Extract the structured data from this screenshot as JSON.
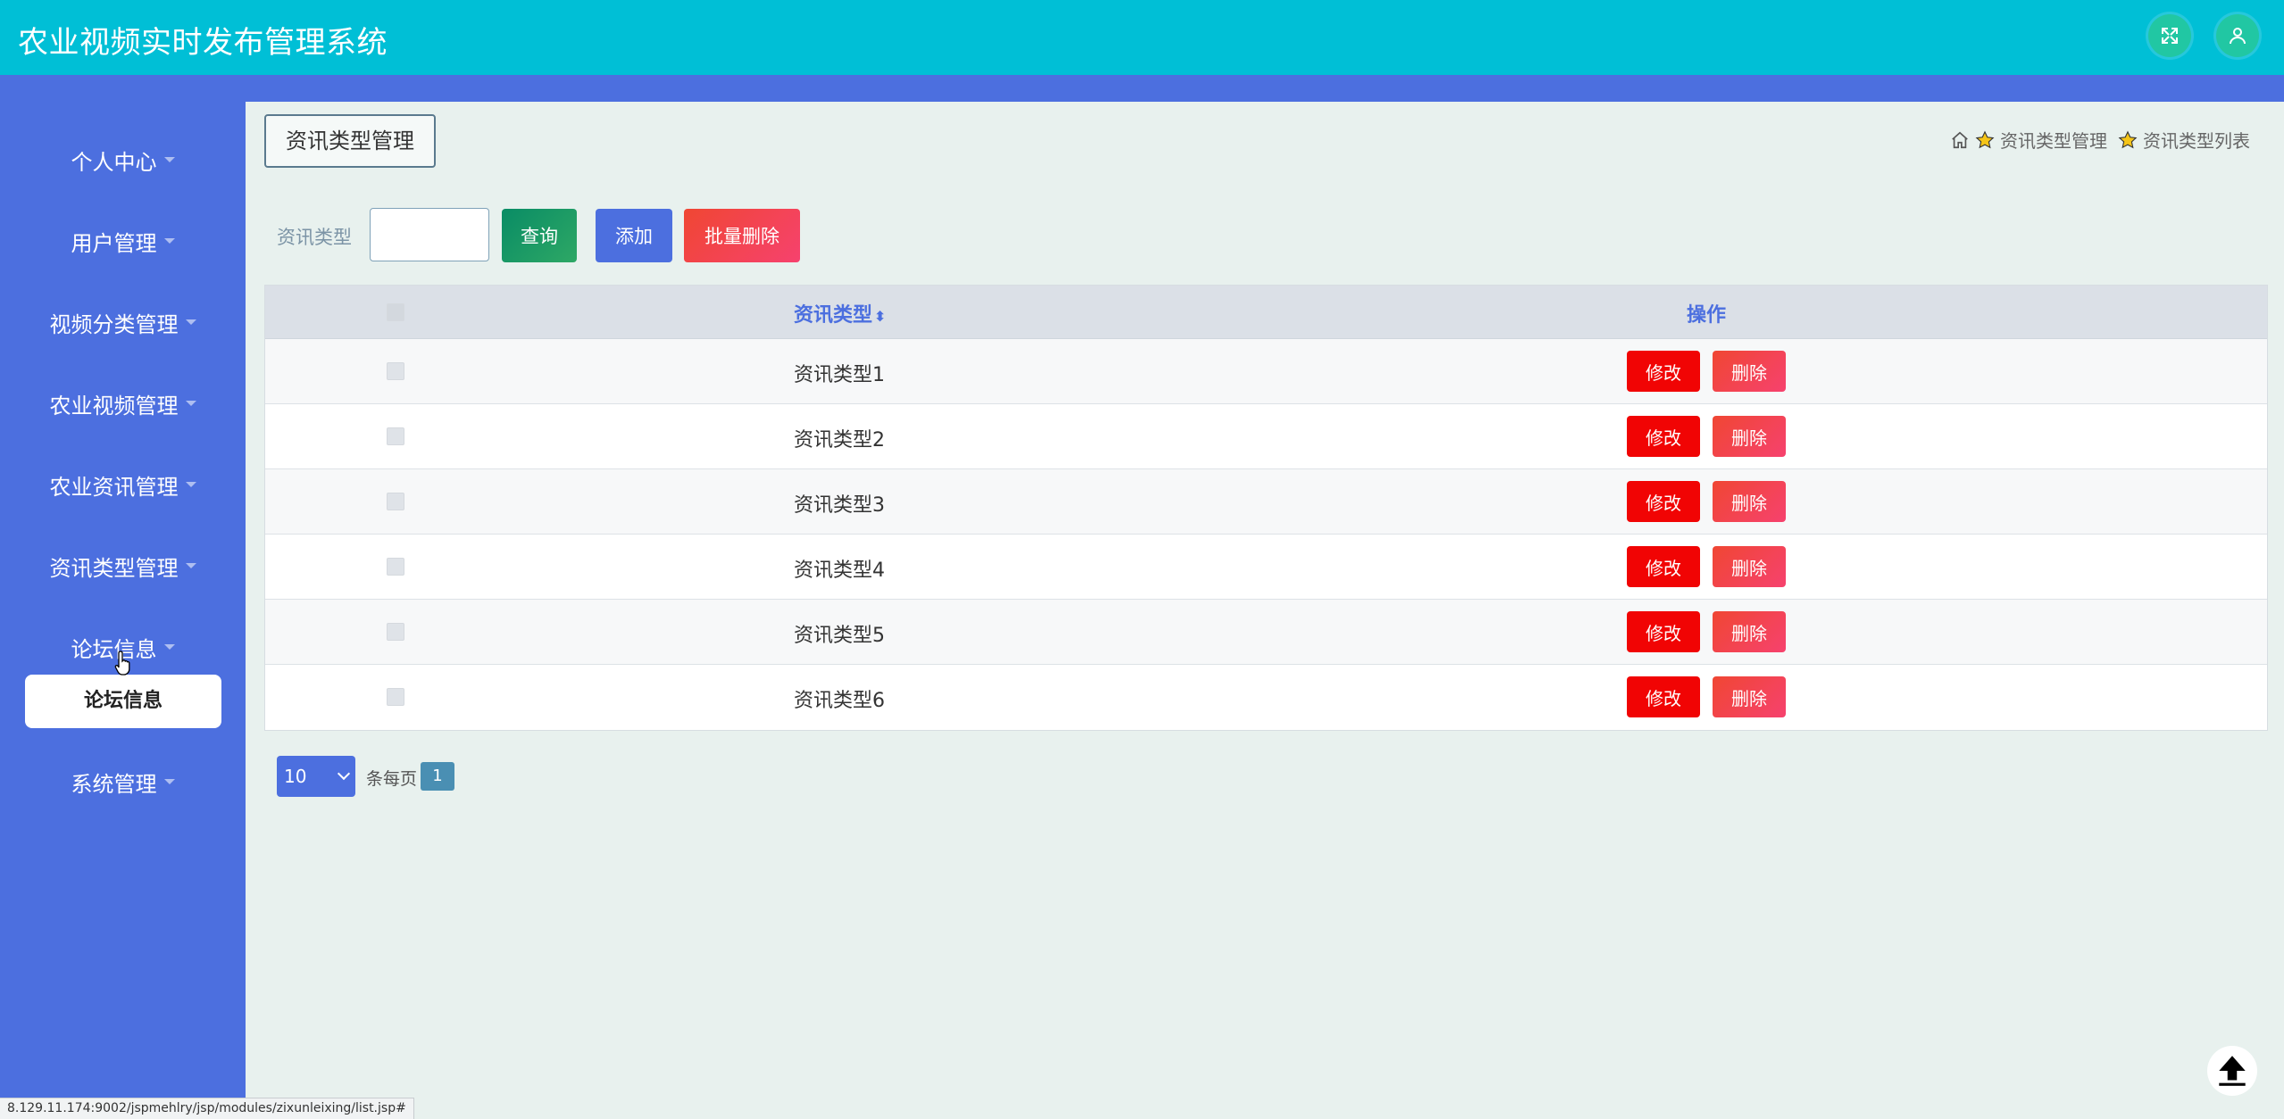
{
  "header": {
    "title": "农业视频实时发布管理系统",
    "fullscreen_icon": "expand-icon",
    "user_icon": "user-icon"
  },
  "sidebar": {
    "items": [
      {
        "label": "个人中心"
      },
      {
        "label": "用户管理"
      },
      {
        "label": "视频分类管理"
      },
      {
        "label": "农业视频管理"
      },
      {
        "label": "农业资讯管理"
      },
      {
        "label": "资讯类型管理"
      },
      {
        "label": "论坛信息"
      },
      {
        "label": "系统管理"
      }
    ],
    "expanded_sub_item": "论坛信息"
  },
  "main": {
    "page_tag": "资讯类型管理",
    "breadcrumb": [
      "资讯类型管理",
      "资讯类型列表"
    ],
    "search": {
      "label": "资讯类型",
      "value": "",
      "placeholder": ""
    },
    "buttons": {
      "query": "查询",
      "add": "添加",
      "batch_delete": "批量删除"
    },
    "table": {
      "columns": [
        "资讯类型",
        "操作"
      ],
      "sort_icon": "⬍",
      "rows": [
        {
          "type": "资讯类型1"
        },
        {
          "type": "资讯类型2"
        },
        {
          "type": "资讯类型3"
        },
        {
          "type": "资讯类型4"
        },
        {
          "type": "资讯类型5"
        },
        {
          "type": "资讯类型6"
        }
      ],
      "edit_label": "修改",
      "delete_label": "删除"
    },
    "pagination": {
      "page_size": "10",
      "per_page_label": "条每页",
      "current_page": "1"
    }
  },
  "status_bar": {
    "url": "8.129.11.174:9002/jspmehlry/jsp/modules/zixunleixing/list.jsp#"
  },
  "colors": {
    "header": "#00bfd6",
    "sidebar": "#4c6fdf",
    "edit": "#f10404",
    "delete": "#f6426e"
  }
}
